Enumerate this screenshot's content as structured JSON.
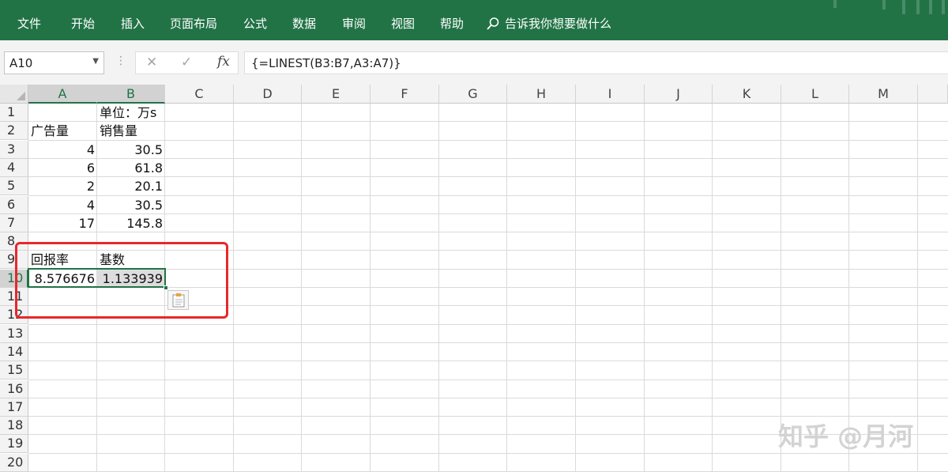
{
  "ribbon": {
    "tabs": [
      "文件",
      "开始",
      "插入",
      "页面布局",
      "公式",
      "数据",
      "审阅",
      "视图",
      "帮助"
    ],
    "tell_me": "告诉我你想要做什么",
    "tell_me_icon": "search-icon",
    "accent_color": "#217346"
  },
  "formula_bar": {
    "name_box": "A10",
    "formula": "{=LINEST(B3:B7,A3:A7)}",
    "cancel_icon": "close-icon",
    "enter_icon": "check-icon",
    "fx_label": "fx"
  },
  "sheet": {
    "columns": [
      "A",
      "B",
      "C",
      "D",
      "E",
      "F",
      "G",
      "H",
      "I",
      "J",
      "K",
      "L",
      "M"
    ],
    "rows": [
      "1",
      "2",
      "3",
      "4",
      "5",
      "6",
      "7",
      "8",
      "9",
      "10",
      "11",
      "12",
      "13",
      "14",
      "15",
      "16",
      "17",
      "18",
      "19",
      "20"
    ],
    "selected_columns": [
      "A",
      "B"
    ],
    "selected_row": "10",
    "cells": {
      "B1": "单位：万s",
      "A2": "广告量",
      "B2": "销售量",
      "A3": "4",
      "B3": "30.5",
      "A4": "6",
      "B4": "61.8",
      "A5": "2",
      "B5": "20.1",
      "A6": "4",
      "B6": "30.5",
      "A7": "17",
      "B7": "145.8",
      "A9": "回报率",
      "B9": "基数",
      "A10": "8.576676",
      "B10": "1.133939"
    },
    "highlight_color": "#e8282b"
  },
  "watermark": "知乎 @月河"
}
